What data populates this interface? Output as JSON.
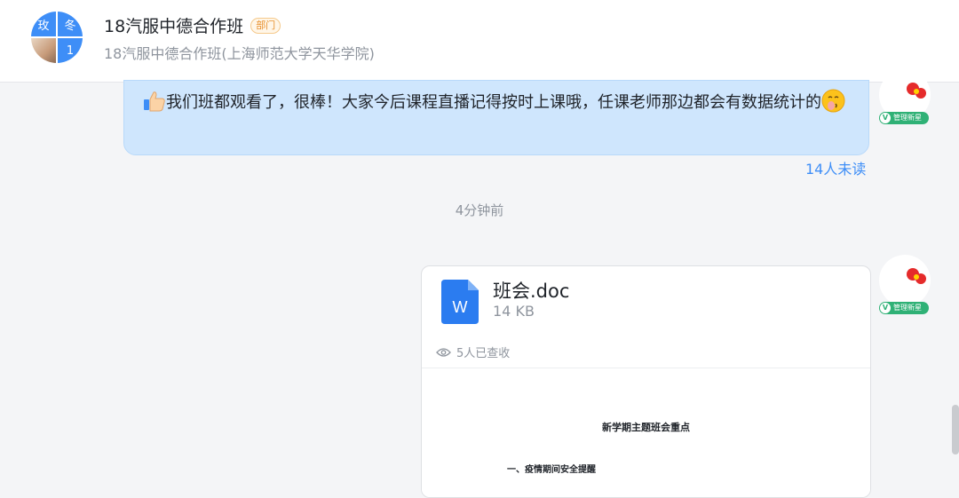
{
  "header": {
    "title": "18汽服中德合作班",
    "tag": "部门",
    "subtitle": "18汽服中德合作班(上海师范大学天华学院)",
    "avatar_cells": [
      "玫",
      "冬",
      "1"
    ]
  },
  "messages": [
    {
      "type": "text",
      "text": "我们班都观看了，很棒！大家今后课程直播记得按时上课哦，任课老师那边都会有数据统计的",
      "emoji_prefix": "thumbs-up-icon",
      "emoji_suffix": "shushing-face-icon",
      "read_status": "14人未读",
      "sender_badge": "管理新星"
    },
    {
      "type": "file",
      "file_name": "班会.doc",
      "file_size": "14 KB",
      "file_icon_letter": "W",
      "receipt": "5人已查收",
      "preview_title": "新学期主题班会重点",
      "preview_heading": "一、疫情期间安全提醒",
      "sender_badge": "管理新星"
    }
  ],
  "time_divider": "4分钟前",
  "colors": {
    "accent": "#3e8ef7",
    "bubble": "#cfe6fd",
    "badge": "#2fb176",
    "tag": "#e8912f",
    "file_icon": "#2b7cf0"
  }
}
